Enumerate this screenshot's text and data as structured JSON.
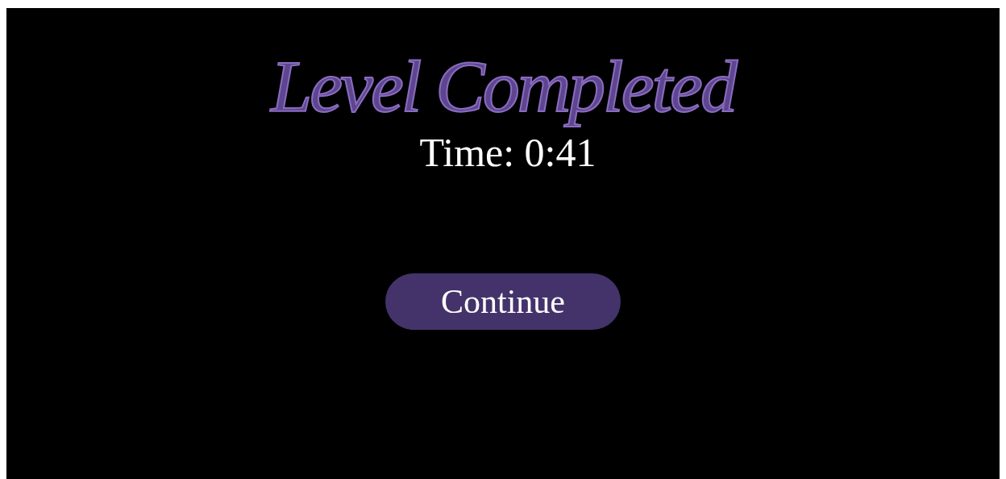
{
  "title": "Level Completed",
  "time": "Time: 0:41",
  "button": "Continue"
}
